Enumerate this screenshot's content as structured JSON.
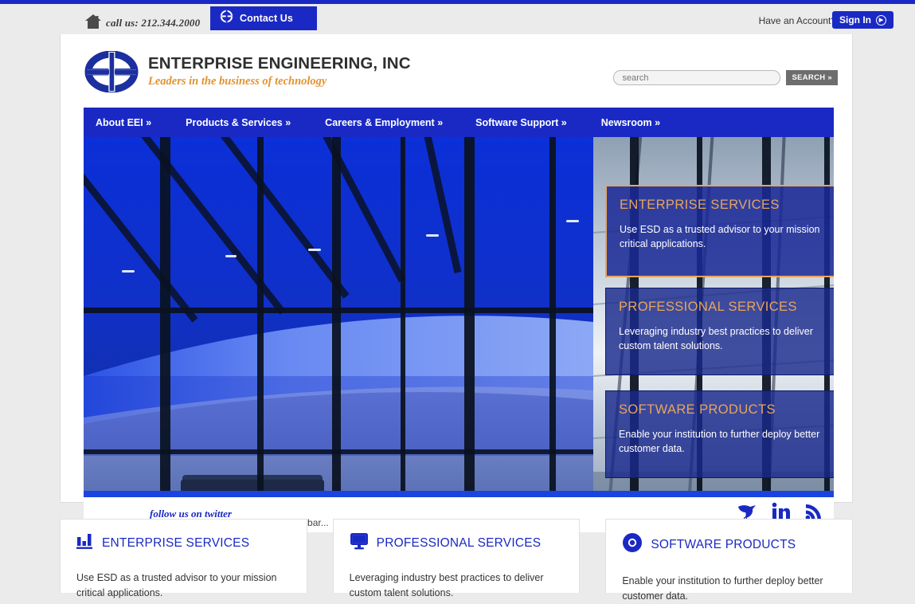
{
  "theme": {
    "brand_blue": "#1a29c4",
    "panel_blue": "#1a298c",
    "accent_orange": "#e8a45c",
    "tagline_orange": "#e3922f",
    "page_bg": "#ebebeb"
  },
  "utility_bar": {
    "home_icon": "home-icon",
    "phone_text": "call us: 212.344.2000",
    "contact_label": "Contact Us",
    "contact_icon": "eei-logo-icon",
    "have_account_text": "Have an Account?",
    "signin_label": "Sign In",
    "signin_icon": "play-circle-icon"
  },
  "header": {
    "logo_icon": "eei-logo-icon",
    "company_name": "ENTERPRISE ENGINEERING, INC",
    "tagline": "Leaders in the business of technology",
    "search": {
      "placeholder": "search",
      "value": "",
      "button_label": "SEARCH",
      "button_icon": "double-chevron-right-icon"
    }
  },
  "nav": {
    "items": [
      {
        "label": "About EEI »"
      },
      {
        "label": "Products & Services »"
      },
      {
        "label": "Careers & Employment »"
      },
      {
        "label": "Software Support »"
      },
      {
        "label": "Newsroom »"
      }
    ]
  },
  "hero": {
    "panels": [
      {
        "title": "ENTERPRISE SERVICES",
        "description": "Use ESD as a trusted advisor to your mission critical applications.",
        "active": true
      },
      {
        "title": "PROFESSIONAL SERVICES",
        "description": "Leveraging industry best practices to deliver custom talent solutions.",
        "active": false
      },
      {
        "title": "SOFTWARE PRODUCTS",
        "description": "Enable your institution to further deploy better customer data.",
        "active": false
      }
    ]
  },
  "social": {
    "follow_label": "follow us on twitter",
    "tweets_status": "Loading tweets bar...",
    "icons": [
      {
        "name": "twitter-bird-icon"
      },
      {
        "name": "linkedin-icon"
      },
      {
        "name": "rss-feed-icon"
      }
    ]
  },
  "cards": [
    {
      "icon": "bar-chart-icon",
      "title": "ENTERPRISE SERVICES",
      "body": "Use ESD as a trusted advisor to your mission critical applications."
    },
    {
      "icon": "monitor-icon",
      "title": "PROFESSIONAL SERVICES",
      "body": "Leveraging industry best practices to deliver custom talent solutions."
    },
    {
      "icon": "circle-dot-icon",
      "title": "SOFTWARE PRODUCTS",
      "body": "Enable your institution to further deploy better customer data."
    }
  ]
}
